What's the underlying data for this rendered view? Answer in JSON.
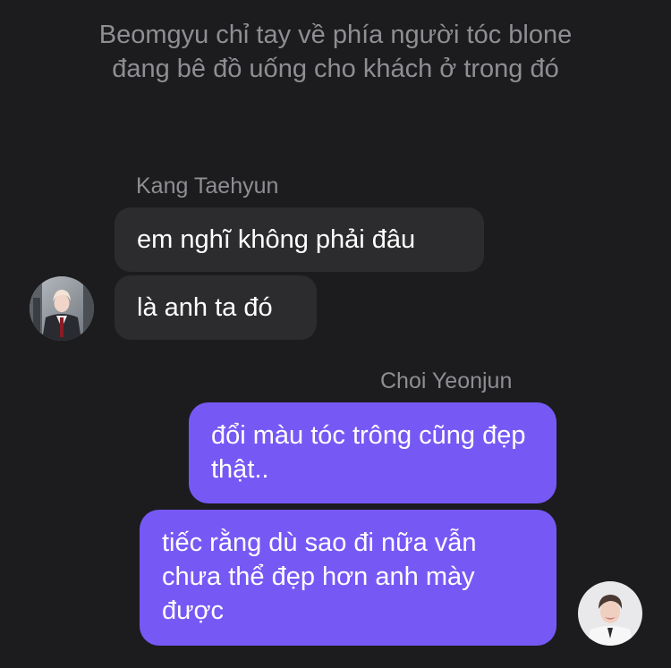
{
  "narration": {
    "text": "Beomgyu chỉ tay về phía người tóc blone đang bê đồ uống cho khách ở trong đó"
  },
  "messages": {
    "kang": {
      "name": "Kang Taehyun",
      "msg1": "em nghĩ không phải đâu",
      "msg2": "là anh ta đó",
      "avatar_icon": "user-avatar-photo"
    },
    "choi": {
      "name": "Choi Yeonjun",
      "msg1": "đổi màu tóc trông cũng đẹp thật..",
      "msg2": "tiếc rằng dù sao đi nữa vẫn chưa thể đẹp hơn anh mày được",
      "avatar_icon": "user-avatar-photo"
    }
  },
  "colors": {
    "background": "#1c1c1e",
    "incoming_bubble": "#2c2c2e",
    "outgoing_bubble": "#7659f5",
    "meta_text": "#8e8e93"
  }
}
